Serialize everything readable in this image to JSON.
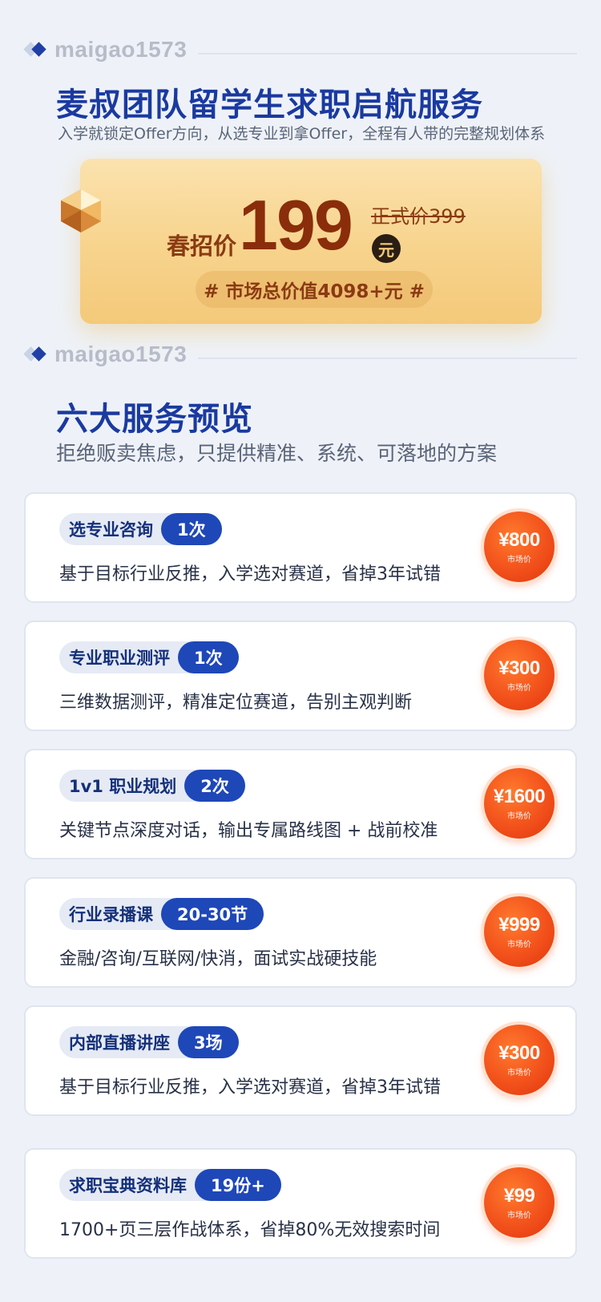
{
  "brand": {
    "watermark": "maigao1573"
  },
  "hero": {
    "title": "麦叔团队留学生求职启航服务",
    "subtitle": "入学就锁定Offer方向，从选专业到拿Offer，全程有人带的完整规划体系"
  },
  "price_card": {
    "label": "春招价",
    "price": "199",
    "currency_unit": "元",
    "original_price": "正式价399",
    "market_value": "# 市场总价值4098+元 #"
  },
  "section": {
    "title": "六大服务预览",
    "subtitle": "拒绝贩卖焦虑，只提供精准、系统、可落地的方案"
  },
  "services": [
    {
      "name": "选专业咨询",
      "count": "1次",
      "desc": "基于目标行业反推，入学选对赛道，省掉3年试错",
      "price": "¥800",
      "price_label": "市场价"
    },
    {
      "name": "专业职业测评",
      "count": "1次",
      "desc": "三维数据测评，精准定位赛道，告别主观判断",
      "price": "¥300",
      "price_label": "市场价"
    },
    {
      "name": "1v1 职业规划",
      "count": "2次",
      "desc": "关键节点深度对话，输出专属路线图 + 战前校准",
      "price": "¥1600",
      "price_label": "市场价"
    },
    {
      "name": "行业录播课",
      "count": "20-30节",
      "desc": "金融/咨询/互联网/快消，面试实战硬技能",
      "price": "¥999",
      "price_label": "市场价"
    },
    {
      "name": "内部直播讲座",
      "count": "3场",
      "desc": "基于目标行业反推，入学选对赛道，省掉3年试错",
      "price": "¥300",
      "price_label": "市场价"
    },
    {
      "name": "求职宝典资料库",
      "count": "19份+",
      "desc": "1700+页三层作战体系，省掉80%无效搜索时间",
      "price": "¥99",
      "price_label": "市场价"
    }
  ],
  "colors": {
    "title_blue": "#1a3aa0",
    "badge_blue": "#1e47b8",
    "price_orange": "#f2511b",
    "card_gold": "#f7d38c"
  }
}
